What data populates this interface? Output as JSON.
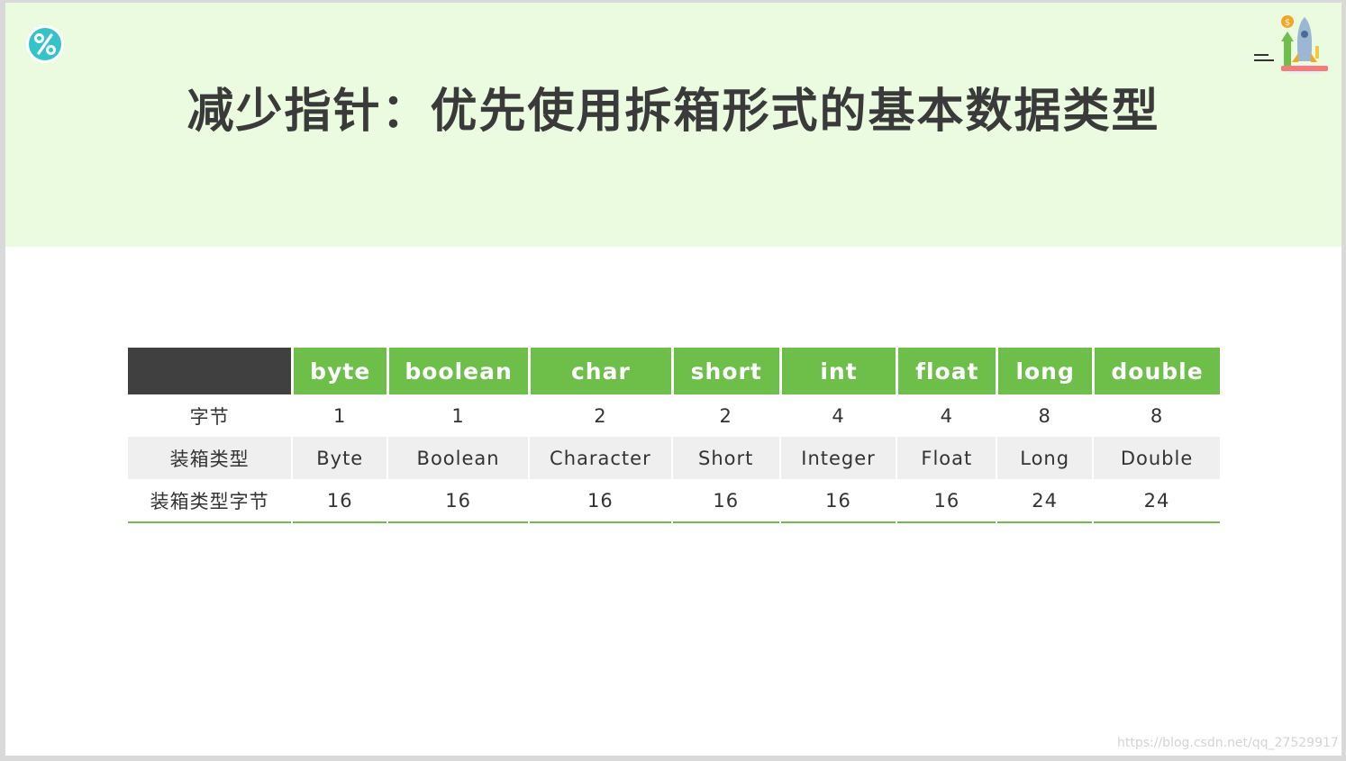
{
  "slide": {
    "title": "减少指针：优先使用拆箱形式的基本数据类型",
    "badge_icon": "percent-icon",
    "decor_icon": "rocket-growth-icon",
    "accent_color": "#6dbf4a",
    "header_bg": "#eafbdf"
  },
  "table": {
    "columns": [
      "byte",
      "boolean",
      "char",
      "short",
      "int",
      "float",
      "long",
      "double"
    ],
    "rows": [
      {
        "label": "字节",
        "cells": [
          "1",
          "1",
          "2",
          "2",
          "4",
          "4",
          "8",
          "8"
        ]
      },
      {
        "label": "装箱类型",
        "cells": [
          "Byte",
          "Boolean",
          "Character",
          "Short",
          "Integer",
          "Float",
          "Long",
          "Double"
        ]
      },
      {
        "label": "装箱类型字节",
        "cells": [
          "16",
          "16",
          "16",
          "16",
          "16",
          "16",
          "24",
          "24"
        ]
      }
    ]
  },
  "watermark": "https://blog.csdn.net/qq_27529917"
}
